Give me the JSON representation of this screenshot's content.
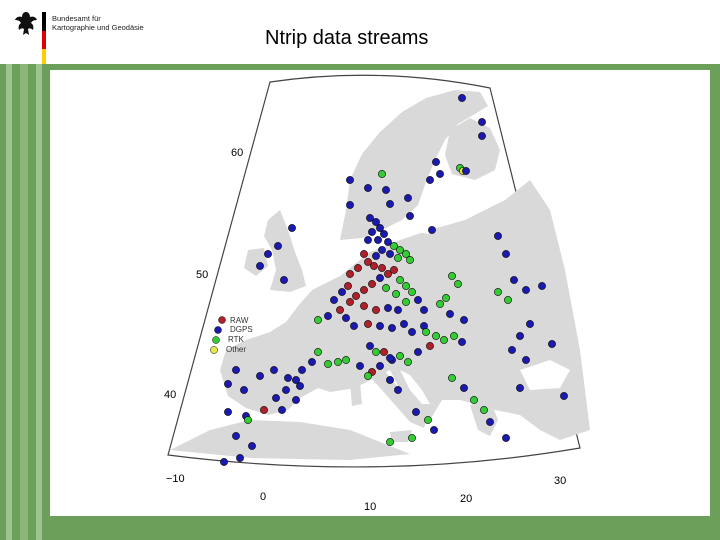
{
  "header": {
    "agency_line1": "Bundesamt für",
    "agency_line2": "Kartographie und Geodäsie",
    "title": "Ntrip data streams"
  },
  "colors": {
    "frame_green": "#6b9f5a",
    "land": "#d9d9d9",
    "raw": "#b0202a",
    "dgps": "#1a1ab0",
    "rtk": "#33cc33",
    "other": "#e8e84a"
  },
  "map": {
    "lat_labels": [
      "60",
      "50",
      "40"
    ],
    "lon_labels": [
      "−10",
      "0",
      "10",
      "20",
      "30"
    ],
    "legend": [
      {
        "label": "RAW",
        "color": "#b0202a"
      },
      {
        "label": "DGPS",
        "color": "#1a1ab0"
      },
      {
        "label": "RTK",
        "color": "#33cc33"
      },
      {
        "label": "Other",
        "color": "#e8e84a"
      }
    ]
  }
}
